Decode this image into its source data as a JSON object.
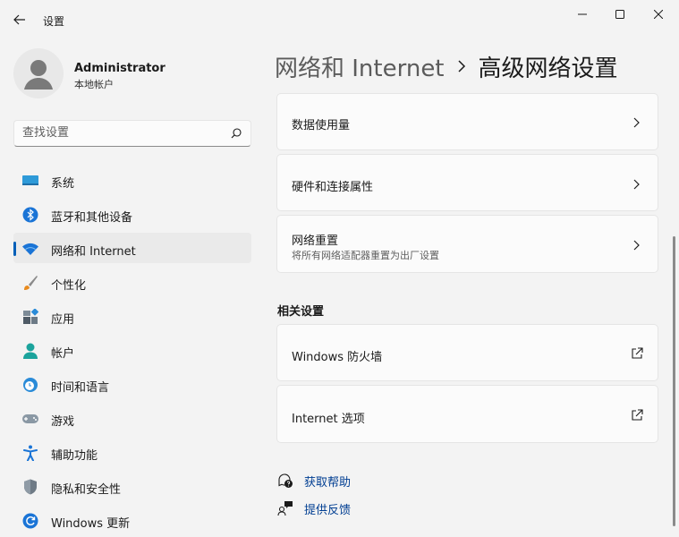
{
  "window": {
    "title": "设置",
    "back_icon": "back-arrow-icon",
    "controls": [
      "minimize-icon",
      "maximize-icon",
      "close-icon"
    ]
  },
  "profile": {
    "name": "Administrator",
    "account_type": "本地帐户"
  },
  "search": {
    "placeholder": "查找设置"
  },
  "sidebar": {
    "items": [
      {
        "label": "系统",
        "icon": "system-icon",
        "active": false
      },
      {
        "label": "蓝牙和其他设备",
        "icon": "bluetooth-icon",
        "active": false
      },
      {
        "label": "网络和 Internet",
        "icon": "wifi-icon",
        "active": true
      },
      {
        "label": "个性化",
        "icon": "brush-icon",
        "active": false
      },
      {
        "label": "应用",
        "icon": "apps-icon",
        "active": false
      },
      {
        "label": "帐户",
        "icon": "account-icon",
        "active": false
      },
      {
        "label": "时间和语言",
        "icon": "time-language-icon",
        "active": false
      },
      {
        "label": "游戏",
        "icon": "gaming-icon",
        "active": false
      },
      {
        "label": "辅助功能",
        "icon": "accessibility-icon",
        "active": false
      },
      {
        "label": "隐私和安全性",
        "icon": "shield-icon",
        "active": false
      },
      {
        "label": "Windows 更新",
        "icon": "windows-update-icon",
        "active": false
      }
    ]
  },
  "breadcrumb": {
    "parent": "网络和 Internet",
    "current": "高级网络设置"
  },
  "main": {
    "cards": [
      {
        "title": "数据使用量",
        "desc": ""
      },
      {
        "title": "硬件和连接属性",
        "desc": ""
      },
      {
        "title": "网络重置",
        "desc": "将所有网络适配器重置为出厂设置"
      }
    ],
    "related_title": "相关设置",
    "related": [
      {
        "title": "Windows 防火墙"
      },
      {
        "title": "Internet 选项"
      }
    ],
    "help_links": {
      "get_help": "获取帮助",
      "feedback": "提供反馈"
    }
  },
  "colors": {
    "accent": "#005fb8",
    "link": "#003e92",
    "background": "#f3f3f3",
    "card": "#fbfbfb"
  }
}
